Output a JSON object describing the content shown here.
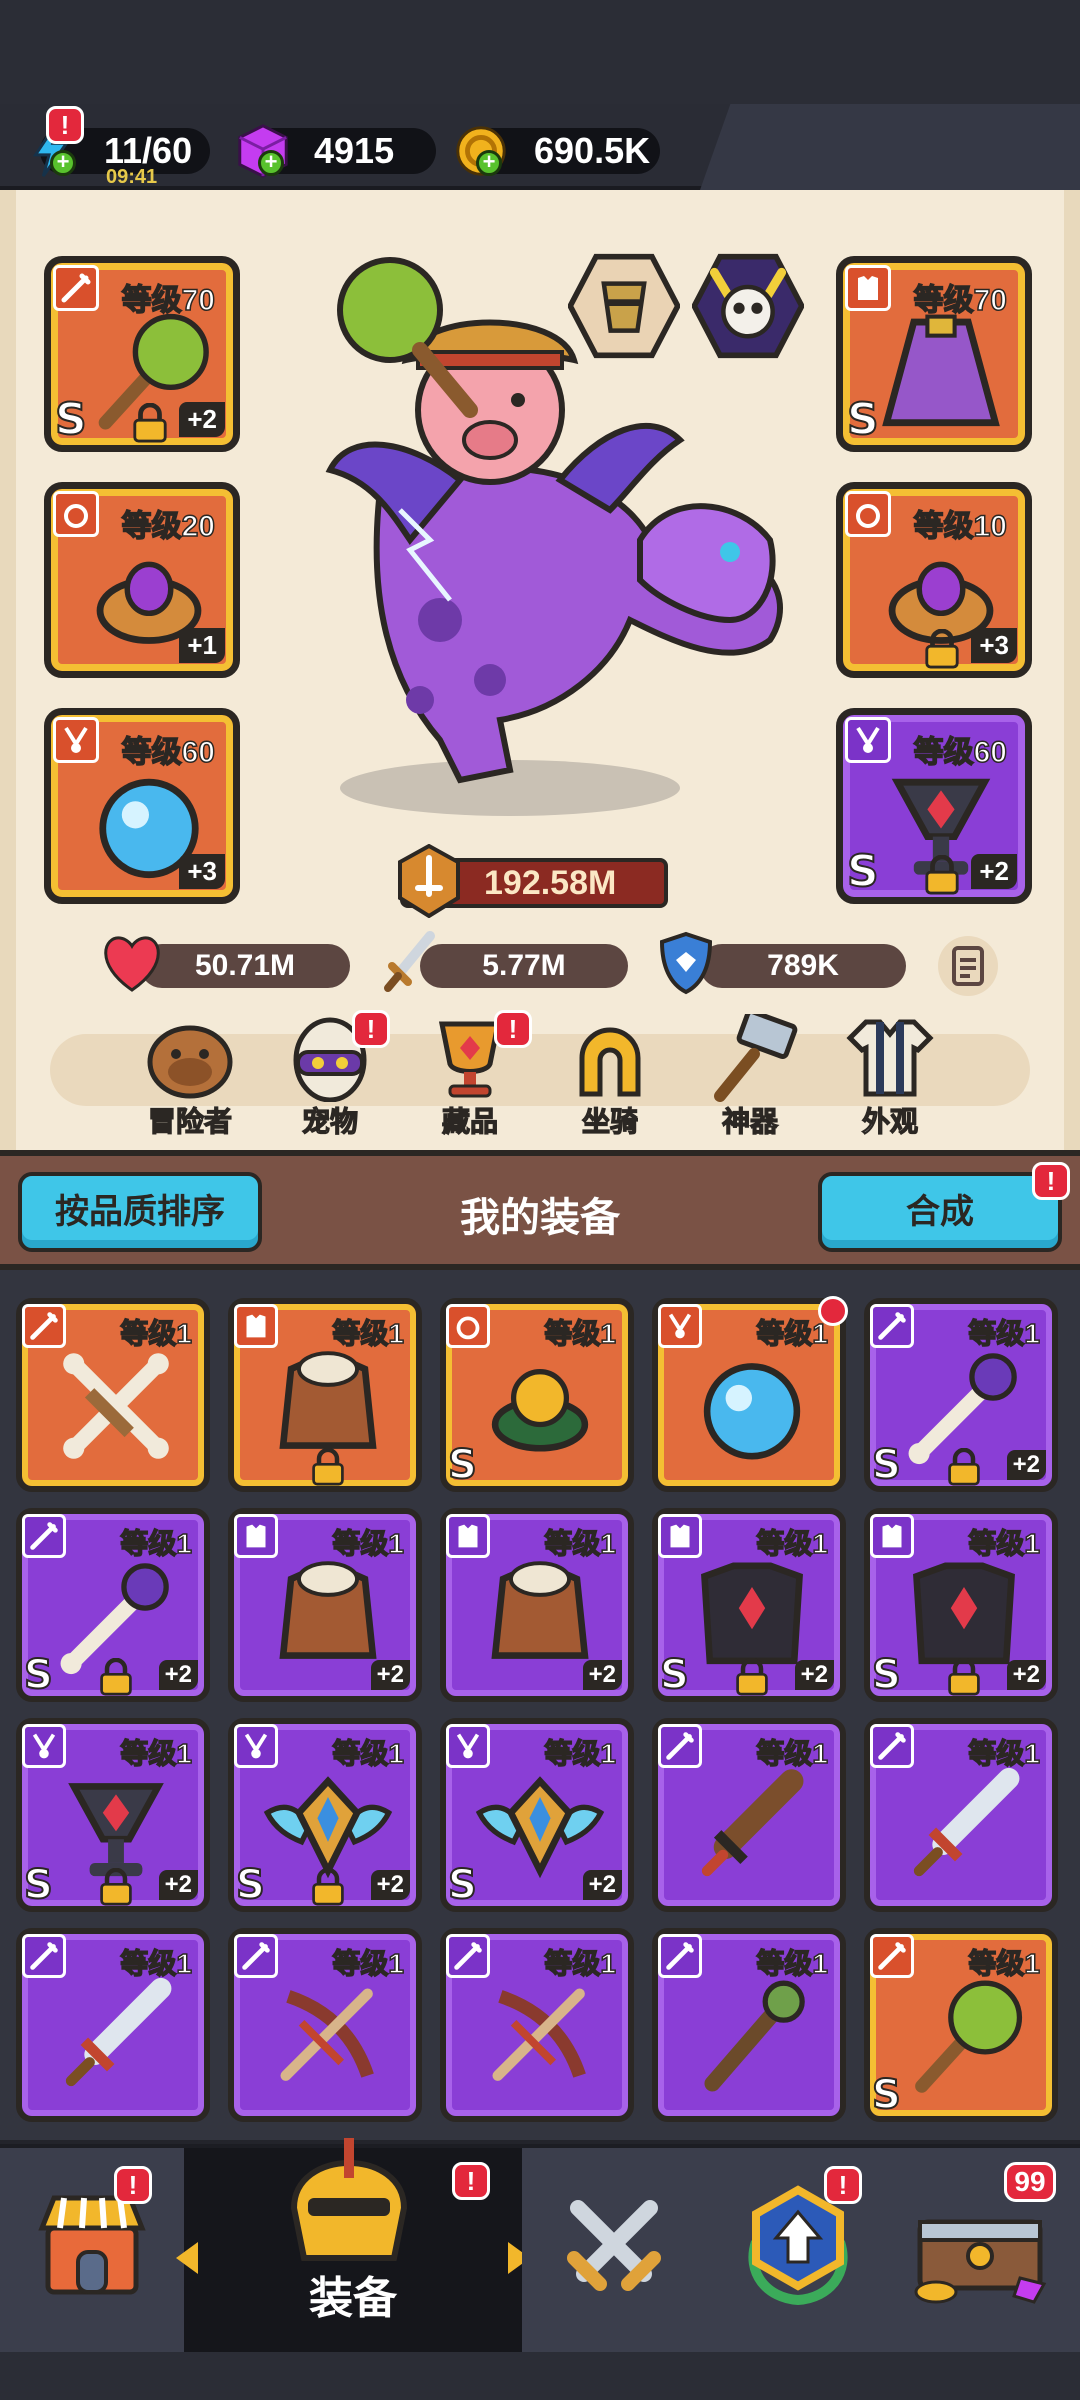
{
  "resources": {
    "energy": "11/60",
    "energy_timer": "09:41",
    "gems": "4915",
    "coins": "690.5K",
    "alert_badge": "!"
  },
  "character": {
    "pets": [
      "knight-pet-icon",
      "skull-pet-icon"
    ],
    "power": "192.58M",
    "stats": {
      "hp": "50.71M",
      "attack": "5.77M",
      "defense": "789K"
    }
  },
  "equipped": [
    {
      "slot": "weapon",
      "level": "等级70",
      "grade": "S",
      "plus": "+2",
      "rarity": "gold",
      "locked": true,
      "icon": "spiked-mace-icon"
    },
    {
      "slot": "armor",
      "level": "等级70",
      "grade": "S",
      "plus": "",
      "rarity": "gold",
      "locked": false,
      "icon": "purple-cape-icon"
    },
    {
      "slot": "ring",
      "level": "等级20",
      "grade": "",
      "plus": "+1",
      "rarity": "gold",
      "locked": false,
      "icon": "gem-ring-icon"
    },
    {
      "slot": "ring",
      "level": "等级10",
      "grade": "",
      "plus": "+3",
      "rarity": "gold",
      "locked": true,
      "icon": "gem-ring-icon"
    },
    {
      "slot": "necklace",
      "level": "等级60",
      "grade": "",
      "plus": "+3",
      "rarity": "gold",
      "locked": false,
      "icon": "crystal-orb-icon"
    },
    {
      "slot": "necklace",
      "level": "等级60",
      "grade": "S",
      "plus": "+2",
      "rarity": "purple",
      "locked": true,
      "icon": "ruby-chalice-icon"
    }
  ],
  "nav": {
    "items": [
      {
        "label": "冒险者",
        "icon": "capybara-icon",
        "alert": false
      },
      {
        "label": "宠物",
        "icon": "egg-icon",
        "alert": true
      },
      {
        "label": "藏品",
        "icon": "trophy-icon",
        "alert": true
      },
      {
        "label": "坐骑",
        "icon": "horseshoe-icon",
        "alert": false
      },
      {
        "label": "神器",
        "icon": "hammer-icon",
        "alert": false
      },
      {
        "label": "外观",
        "icon": "outfit-icon",
        "alert": false
      }
    ]
  },
  "equipment_header": {
    "sort_label": "按品质排序",
    "title": "我的装备",
    "merge_label": "合成"
  },
  "inventory": [
    {
      "level": "等级1",
      "rarity": "gold",
      "grade": "",
      "plus": "",
      "locked": false,
      "type": "weapon",
      "icon": "crossed-bones-icon"
    },
    {
      "level": "等级1",
      "rarity": "gold",
      "grade": "",
      "plus": "",
      "locked": true,
      "type": "armor",
      "icon": "fur-armor-icon"
    },
    {
      "level": "等级1",
      "rarity": "gold",
      "grade": "S",
      "plus": "",
      "locked": false,
      "type": "ring",
      "icon": "amber-ring-icon"
    },
    {
      "level": "等级1",
      "rarity": "gold",
      "grade": "",
      "plus": "",
      "locked": false,
      "type": "necklace",
      "icon": "crystal-orb-icon",
      "new": true
    },
    {
      "level": "等级1",
      "rarity": "purple",
      "grade": "S",
      "plus": "+2",
      "locked": true,
      "type": "weapon",
      "icon": "bone-staff-icon"
    },
    {
      "level": "等级1",
      "rarity": "purple",
      "grade": "S",
      "plus": "+2",
      "locked": true,
      "type": "weapon",
      "icon": "bone-staff-icon"
    },
    {
      "level": "等级1",
      "rarity": "purple",
      "grade": "",
      "plus": "+2",
      "locked": false,
      "type": "armor",
      "icon": "fur-armor-icon"
    },
    {
      "level": "等级1",
      "rarity": "purple",
      "grade": "",
      "plus": "+2",
      "locked": false,
      "type": "armor",
      "icon": "fur-armor-icon"
    },
    {
      "level": "等级1",
      "rarity": "purple",
      "grade": "S",
      "plus": "+2",
      "locked": true,
      "type": "armor",
      "icon": "dark-plate-icon"
    },
    {
      "level": "等级1",
      "rarity": "purple",
      "grade": "S",
      "plus": "+2",
      "locked": true,
      "type": "armor",
      "icon": "dark-plate-icon"
    },
    {
      "level": "等级1",
      "rarity": "purple",
      "grade": "S",
      "plus": "+2",
      "locked": true,
      "type": "necklace",
      "icon": "ruby-chalice-icon"
    },
    {
      "level": "等级1",
      "rarity": "purple",
      "grade": "S",
      "plus": "+2",
      "locked": true,
      "type": "necklace",
      "icon": "winged-shield-icon"
    },
    {
      "level": "等级1",
      "rarity": "purple",
      "grade": "S",
      "plus": "+2",
      "locked": false,
      "type": "necklace",
      "icon": "winged-shield-icon"
    },
    {
      "level": "等级1",
      "rarity": "purple",
      "grade": "",
      "plus": "",
      "locked": false,
      "type": "weapon",
      "icon": "wooden-sword-icon"
    },
    {
      "level": "等级1",
      "rarity": "purple",
      "grade": "",
      "plus": "",
      "locked": false,
      "type": "weapon",
      "icon": "steel-sword-icon"
    },
    {
      "level": "等级1",
      "rarity": "purple",
      "grade": "",
      "plus": "",
      "locked": false,
      "type": "weapon",
      "icon": "steel-sword-icon"
    },
    {
      "level": "等级1",
      "rarity": "purple",
      "grade": "",
      "plus": "",
      "locked": false,
      "type": "weapon",
      "icon": "crossbow-icon"
    },
    {
      "level": "等级1",
      "rarity": "purple",
      "grade": "",
      "plus": "",
      "locked": false,
      "type": "weapon",
      "icon": "crossbow-icon"
    },
    {
      "level": "等级1",
      "rarity": "purple",
      "grade": "",
      "plus": "",
      "locked": false,
      "type": "weapon",
      "icon": "wooden-staff-icon"
    },
    {
      "level": "等级1",
      "rarity": "gold",
      "grade": "S",
      "plus": "",
      "locked": false,
      "type": "weapon",
      "icon": "spiked-mace-icon"
    }
  ],
  "bottom_nav": {
    "active_label": "装备",
    "chest_count": "99",
    "tabs": [
      "shop-icon",
      "helmet-icon",
      "crossed-swords-icon",
      "upgrade-icon",
      "treasure-chest-icon"
    ]
  },
  "colors": {
    "gold_frame": "#f4bf33",
    "gold_fill": "#e26c3d",
    "purple_frame": "#a862ea",
    "purple_fill": "#8a3ed6",
    "panel_bg": "#f4ead7",
    "cyan_button": "#3fc6e8",
    "alert_red": "#e3283c"
  }
}
